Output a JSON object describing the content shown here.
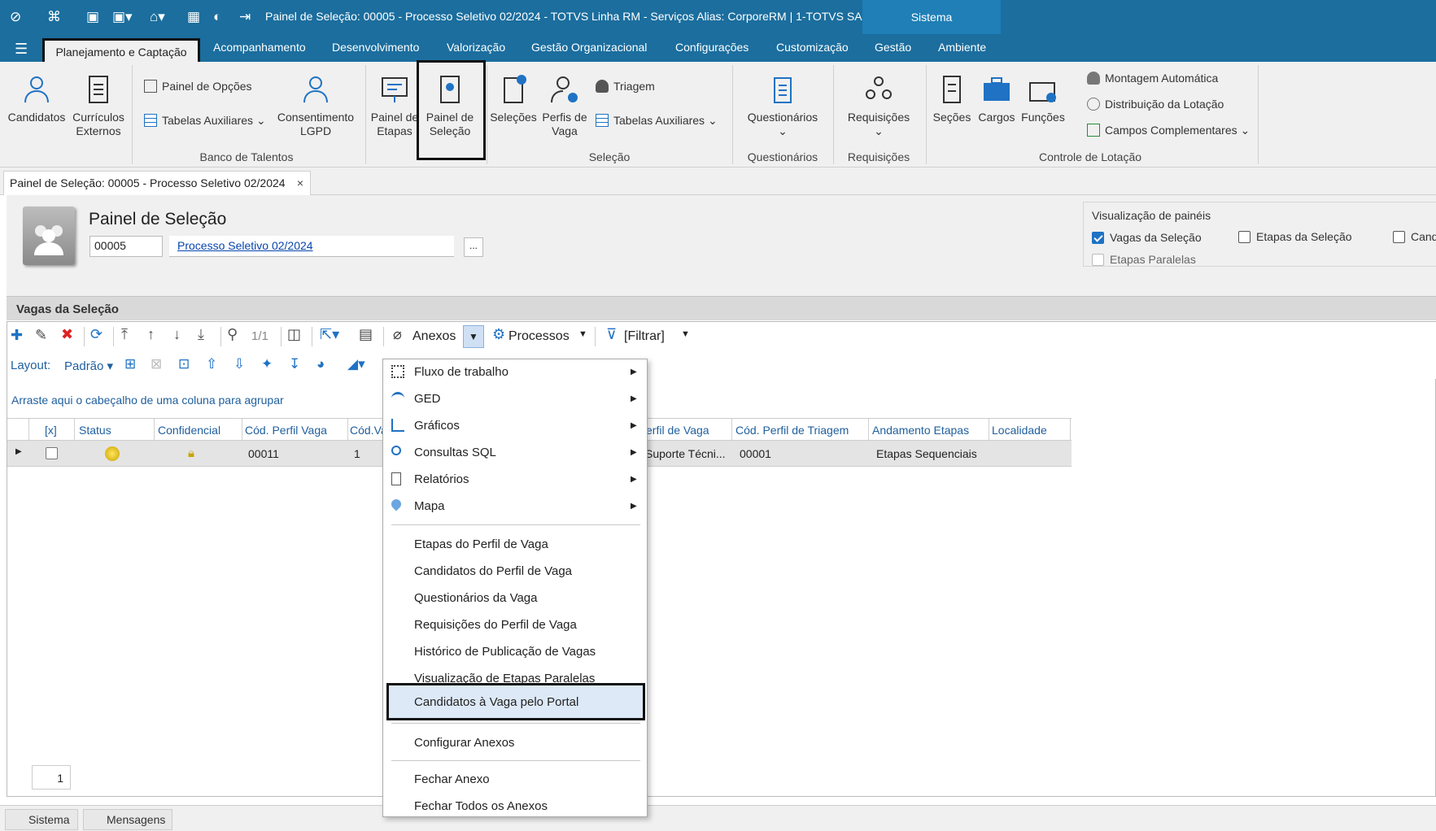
{
  "window": {
    "title": "Painel de Seleção: 00005 - Processo Seletivo 02/2024 - TOTVS Linha RM - Serviços  Alias: CorporeRM | 1-TOTVS SA",
    "sistema_tab": "Sistema"
  },
  "menubar": {
    "items": [
      "Planejamento e Captação",
      "Acompanhamento",
      "Desenvolvimento",
      "Valorização",
      "Gestão Organizacional",
      "Configurações",
      "Customização",
      "Gestão",
      "Ambiente"
    ],
    "active": "Planejamento e Captação"
  },
  "ribbon": {
    "candidatos": "Candidatos",
    "curriculos": "Currículos Externos",
    "painel_opcoes": "Painel de Opções",
    "tabelas_aux1": "Tabelas Auxiliares",
    "consentimento": "Consentimento LGPD",
    "banco_talentos": "Banco de Talentos",
    "painel_etapas": "Painel de Etapas",
    "painel_selecao": "Painel de Seleção",
    "selecoes": "Seleções",
    "perfis_vaga": "Perfis de Vaga",
    "triagem": "Triagem",
    "tabelas_aux2": "Tabelas Auxiliares",
    "selecao_group": "Seleção",
    "questionarios": "Questionários",
    "questionarios_group": "Questionários",
    "requisicoes": "Requisições",
    "requisicoes_group": "Requisições",
    "secoes": "Seções",
    "cargos": "Cargos",
    "funcoes": "Funções",
    "montagem": "Montagem Automática",
    "distribuicao": "Distribuição da Lotação",
    "campos_compl": "Campos Complementares",
    "controle_lotacao": "Controle de Lotação"
  },
  "doc_tab": {
    "label": "Painel de Seleção: 00005 - Processo Seletivo 02/2024",
    "close": "×"
  },
  "header": {
    "title": "Painel de Seleção",
    "code": "00005",
    "process_link": "Processo Seletivo 02/2024",
    "dots": "..."
  },
  "visualizacao": {
    "title": "Visualização de painéis",
    "vagas": "Vagas da Seleção",
    "etapas": "Etapas da Seleção",
    "candidatos": "Candi",
    "paralelas": "Etapas Paralelas"
  },
  "section_title": "Vagas da Seleção",
  "toolbar": {
    "page_indicator": "1/1",
    "anexos": "Anexos",
    "processos": "Processos",
    "filtrar": "[Filtrar]",
    "layout_label": "Layout:",
    "layout_value": "Padrão"
  },
  "grid": {
    "group_hint": "Arraste aqui o cabeçalho de uma coluna para agrupar",
    "columns": [
      "[x]",
      "Status",
      "Confidencial",
      "Cód. Perfil Vaga",
      "Cód.Va",
      "erfil de Vaga",
      "Cód. Perfil de Triagem",
      "Andamento Etapas",
      "Localidade"
    ],
    "row": {
      "cod_perfil": "00011",
      "cod_vaga": "1",
      "perfil": "Suporte Técni...",
      "triagem": "00001",
      "andamento": "Etapas Sequenciais"
    },
    "pager": "1"
  },
  "dropdown": {
    "submenus": [
      "Fluxo de trabalho",
      "GED",
      "Gráficos",
      "Consultas SQL",
      "Relatórios",
      "Mapa"
    ],
    "items": [
      "Etapas do Perfil de Vaga",
      "Candidatos do Perfil de Vaga",
      "Questionários da Vaga",
      "Requisições do Perfil de Vaga",
      "Histórico de Publicação de Vagas",
      "Visualização de Etapas Paralelas"
    ],
    "highlighted": "Candidatos à Vaga pelo Portal",
    "configurar": "Configurar Anexos",
    "fechar": "Fechar Anexo",
    "fechar_todos": "Fechar Todos os Anexos"
  },
  "statusbar": {
    "sistema": "Sistema",
    "mensagens": "Mensagens"
  },
  "colors": {
    "titlebar": "#1b6e9e",
    "accent": "#1f72c4",
    "highlight_border": "#111111"
  }
}
